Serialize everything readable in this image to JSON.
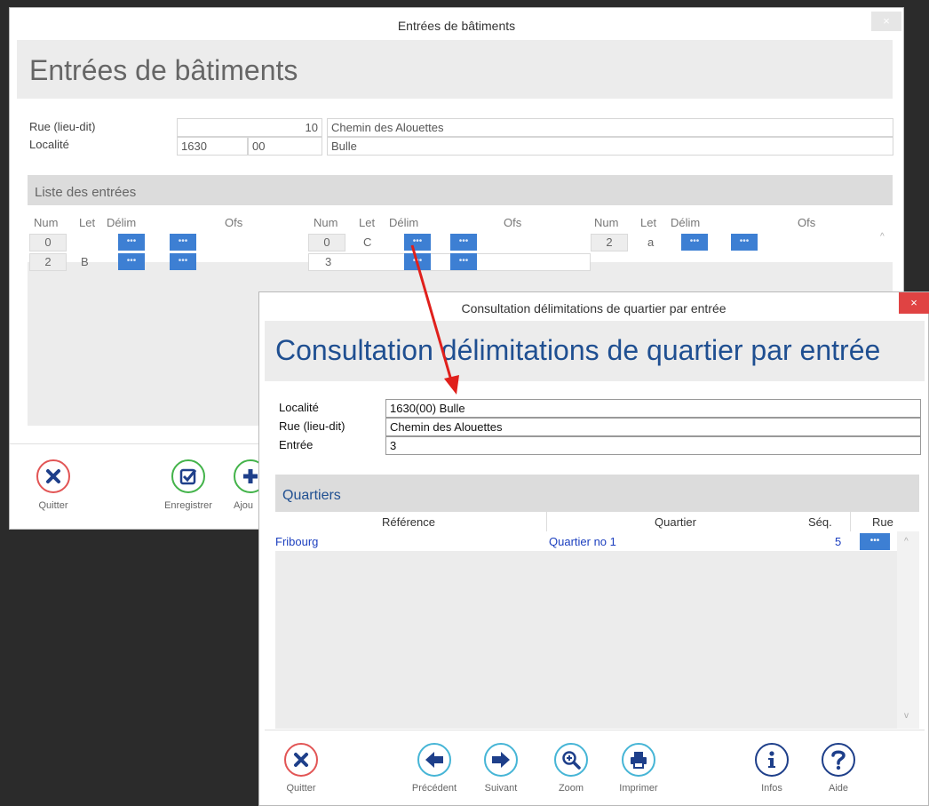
{
  "bg_window": {
    "title": "Entrées de bâtiments",
    "close": "×",
    "header": "Entrées de bâtiments",
    "rue_label": "Rue (lieu-dit)",
    "localite_label": "Localité",
    "rue_number": "10",
    "rue_name": "Chemin des Alouettes",
    "npa": "1630",
    "npa_suffix": "00",
    "localite_name": "Bulle",
    "list_title": "Liste des entrées",
    "columns": [
      "Num",
      "Let",
      "Délim",
      "Ofs"
    ],
    "entries": [
      {
        "num": "0",
        "let": ""
      },
      {
        "num": "2",
        "let": "B"
      },
      {
        "num": "0",
        "let": "C"
      },
      {
        "num": "3",
        "let": ""
      },
      {
        "num": "2",
        "let": "a"
      }
    ],
    "dots": "•••",
    "scroll_up": "^",
    "buttons": {
      "quit": "Quitter",
      "save": "Enregistrer",
      "add": "Ajou"
    }
  },
  "fg_window": {
    "title": "Consultation délimitations de quartier par entrée",
    "close": "×",
    "header": "Consultation délimitations de quartier par entrée",
    "localite_label": "Localité",
    "rue_label": "Rue (lieu-dit)",
    "entree_label": "Entrée",
    "localite_value": "1630(00) Bulle",
    "rue_value": "Chemin des Alouettes",
    "entree_value": "3",
    "section_title": "Quartiers",
    "columns": {
      "reference": "Référence",
      "quartier": "Quartier",
      "seq": "Séq.",
      "rue": "Rue"
    },
    "rows": [
      {
        "reference": "Fribourg",
        "quartier": "Quartier no 1",
        "seq": "5",
        "rue": "•••"
      }
    ],
    "scroll_up": "^",
    "scroll_down": "v",
    "buttons": {
      "quit": "Quitter",
      "previous": "Précédent",
      "next": "Suivant",
      "zoom": "Zoom",
      "print": "Imprimer",
      "info": "Infos",
      "help": "Aide"
    }
  },
  "colors": {
    "accent_blue": "#3d7fd3",
    "title_blue": "#1f4f91",
    "close_red": "#e04343",
    "arrow_red": "#e0201c"
  }
}
